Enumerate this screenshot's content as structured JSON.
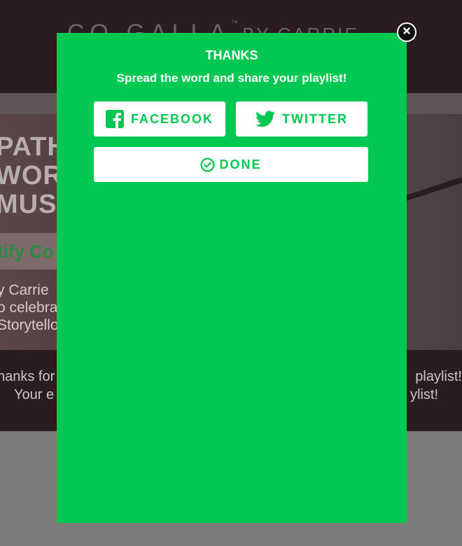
{
  "background": {
    "logo_main": "CO GALLA",
    "logo_tm": "™",
    "logo_by": "BY CARRIE",
    "hero_title_lines": [
      "PATH",
      "WOR",
      "MUS"
    ],
    "band_text": "tify Co",
    "copy_lines": [
      "y Carrie",
      "o celebra",
      "Storytello"
    ],
    "thanks_left_lines": [
      "hanks for",
      "Your e"
    ],
    "thanks_right_lines": [
      "playlist!",
      "ylist!"
    ]
  },
  "modal": {
    "title": "THANKS",
    "subtitle": "Spread the word and share your playlist!",
    "facebook_label": "FACEBOOK",
    "twitter_label": "TWITTER",
    "done_label": "DONE"
  },
  "colors": {
    "modal_bg": "#00c853",
    "button_text": "#00c853",
    "button_bg": "#ffffff"
  },
  "icons": [
    "facebook-icon",
    "twitter-icon",
    "check-circle-icon",
    "close-icon"
  ]
}
